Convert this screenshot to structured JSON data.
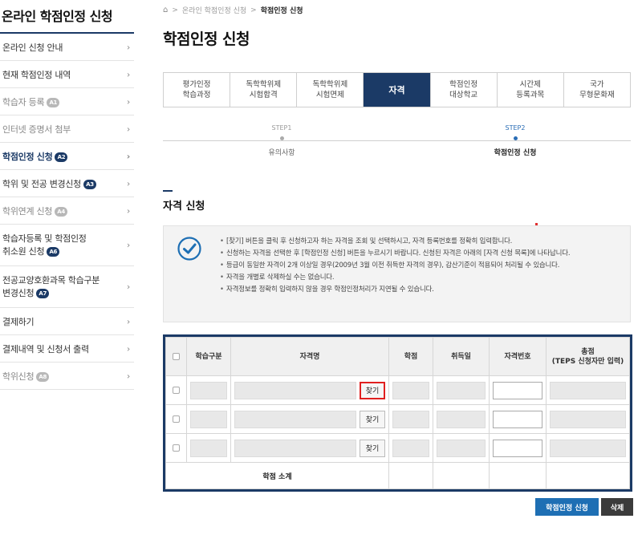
{
  "sidebar": {
    "title": "온라인 학점인정 신청",
    "items": [
      {
        "label": "온라인 신청 안내",
        "badge": "",
        "state": "normal"
      },
      {
        "label": "현재 학점인정 내역",
        "badge": "",
        "state": "normal"
      },
      {
        "label": "학습자 등록",
        "badge": "A1",
        "state": "dim"
      },
      {
        "label": "인터넷 증명서 첨부",
        "badge": "",
        "state": "dim"
      },
      {
        "label": "학점인정 신청",
        "badge": "A2",
        "state": "active"
      },
      {
        "label": "학위 및 전공 변경신청",
        "badge": "A3",
        "state": "normal"
      },
      {
        "label": "학위연계 신청",
        "badge": "A4",
        "state": "dim"
      },
      {
        "label": "학습자등록 및 학점인정",
        "label2": "취소원 신청",
        "badge": "A6",
        "state": "normal"
      },
      {
        "label": "전공교양호환과목 학습구분",
        "label2": "변경신청",
        "badge": "A7",
        "state": "normal"
      },
      {
        "label": "결제하기",
        "badge": "",
        "state": "normal"
      },
      {
        "label": "결제내역 및 신청서 출력",
        "badge": "",
        "state": "normal"
      },
      {
        "label": "학위신청",
        "badge": "A8",
        "state": "dim"
      }
    ]
  },
  "breadcrumb": {
    "home_icon": "home-icon",
    "items": [
      "온라인 학점인정 신청",
      "학점인정 신청"
    ]
  },
  "page_title": "학점인정 신청",
  "tabs": [
    {
      "label": "평가인정\n학습과정",
      "active": false
    },
    {
      "label": "독학학위제\n시험합격",
      "active": false
    },
    {
      "label": "독학학위제\n시험면제",
      "active": false
    },
    {
      "label": "자격",
      "active": true
    },
    {
      "label": "학점인정\n대상학교",
      "active": false
    },
    {
      "label": "시간제\n등록과목",
      "active": false
    },
    {
      "label": "국가\n무형문화재",
      "active": false
    }
  ],
  "steps": [
    {
      "num": "STEP1",
      "label": "유의사항",
      "active": false
    },
    {
      "num": "STEP2",
      "label": "학점인정 신청",
      "active": true
    }
  ],
  "section_title": "자격 신청",
  "notice": {
    "icon": "check-circle-icon",
    "items": [
      "[찾기] 버튼을 클릭 후 신청하고자 하는 자격을 조회 및 선택하시고, 자격 등록번호를 정확히 입력합니다.",
      "신청하는 자격을 선택한 후 [학점인정 신청] 버튼을 누르시기 바랍니다. 신청된 자격은 아래의 [자격 신청 목록]에 나타납니다.",
      "등급이 동일한 자격이 2개 이상일 경우(2009년 3월 이전 취득한 자격의 경우), 감산기준이 적용되어 처리될 수 있습니다.",
      "자격을 개별로 삭제하실 수는 없습니다.",
      "자격정보를 정확히 입력하지 않을 경우 학점인정처리가 지연될 수 있습니다."
    ]
  },
  "table": {
    "headers": [
      "학습구분",
      "자격명",
      "학점",
      "취득일",
      "자격번호",
      "총점\n(TEPS 신청자만 입력)"
    ],
    "find_label": "찾기",
    "row_count": 3,
    "subtotal_label": "학점 소계"
  },
  "buttons": {
    "apply": "학점인정 신청",
    "delete": "삭제"
  }
}
